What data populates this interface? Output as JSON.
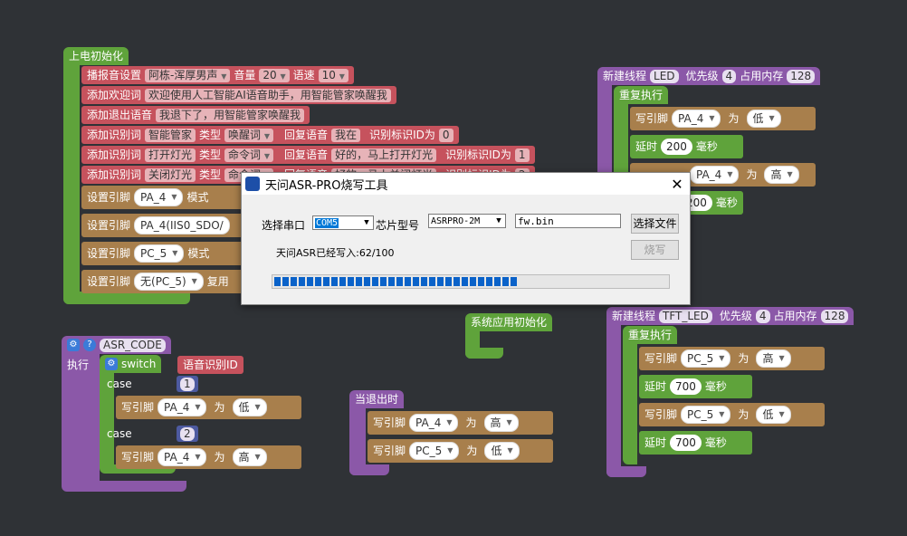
{
  "init_block": {
    "hat": "上电初始化",
    "rows": [
      {
        "kind": "tts",
        "label": "播报音设置",
        "voice": "阿栋-浑厚男声",
        "vol_label": "音量",
        "vol": "20",
        "speed_label": "语速",
        "speed": "10"
      },
      {
        "label": "添加欢迎词",
        "text": "欢迎使用人工智能AI语音助手，用智能管家唤醒我"
      },
      {
        "label": "添加退出语音",
        "text": "我退下了，用智能管家唤醒我"
      },
      {
        "label": "添加识别词",
        "word": "智能管家",
        "type_label": "类型",
        "type": "唤醒词",
        "reply_label": "回复语音",
        "reply": "我在",
        "id_label": "识别标识ID为",
        "id": "0"
      },
      {
        "label": "添加识别词",
        "word": "打开灯光",
        "type_label": "类型",
        "type": "命令词",
        "reply_label": "回复语音",
        "reply": "好的，马上打开灯光",
        "id_label": "识别标识ID为",
        "id": "1"
      },
      {
        "label": "添加识别词",
        "word": "关闭灯光",
        "type_label": "类型",
        "type": "命令词",
        "reply_label": "回复语音",
        "reply": "好的，马上关闭灯光",
        "id_label": "识别标识ID为",
        "id": "2"
      }
    ],
    "pins": [
      {
        "label": "设置引脚",
        "pin": "PA_4",
        "mode_label": "模式"
      },
      {
        "label": "设置引脚",
        "pin": "PA_4(IIS0_SDO/"
      },
      {
        "label": "设置引脚",
        "pin": "PC_5",
        "mode_label": "模式"
      },
      {
        "label": "设置引脚",
        "pin": "无(PC_5)",
        "mode_label": "复用"
      }
    ]
  },
  "thread_led": {
    "hat_label": "新建线程",
    "name": "LED",
    "prio_label": "优先级",
    "prio": "4",
    "mem_label": "占用内存",
    "mem": "128",
    "repeat": "重复执行",
    "write1": {
      "label": "写引脚",
      "pin": "PA_4",
      "as": "为",
      "val": "低"
    },
    "delay1": {
      "label": "延时",
      "val": "200",
      "unit": "毫秒"
    },
    "write2": {
      "label": "写引脚",
      "pin": "PA_4",
      "as": "为",
      "val": "高"
    },
    "delay2": {
      "val": "200",
      "unit": "毫秒"
    }
  },
  "thread_tft": {
    "hat_label": "新建线程",
    "name": "TFT_LED",
    "prio_label": "优先级",
    "prio": "4",
    "mem_label": "占用内存",
    "mem": "128",
    "repeat": "重复执行",
    "write1": {
      "label": "写引脚",
      "pin": "PC_5",
      "as": "为",
      "val": "高"
    },
    "delay1": {
      "label": "延时",
      "val": "700",
      "unit": "毫秒"
    },
    "write2": {
      "label": "写引脚",
      "pin": "PC_5",
      "as": "为",
      "val": "低"
    },
    "delay2": {
      "label": "延时",
      "val": "700",
      "unit": "毫秒"
    }
  },
  "asr_block": {
    "name": "ASR_CODE",
    "exec": "执行",
    "switch": "switch",
    "switch_arg": "语音识别ID",
    "case_label": "case",
    "case1": "1",
    "case2": "2",
    "write1": {
      "label": "写引脚",
      "pin": "PA_4",
      "as": "为",
      "val": "低"
    },
    "write2": {
      "label": "写引脚",
      "pin": "PA_4",
      "as": "为",
      "val": "高"
    }
  },
  "sys_init": "系统应用初始化",
  "exit_block": {
    "hat": "当退出时",
    "write1": {
      "label": "写引脚",
      "pin": "PA_4",
      "as": "为",
      "val": "高"
    },
    "write2": {
      "label": "写引脚",
      "pin": "PC_5",
      "as": "为",
      "val": "低"
    }
  },
  "dialog": {
    "title": "天问ASR-PRO烧写工具",
    "port_label": "选择串口",
    "port": "COM5",
    "chip_label": "芯片型号",
    "chip": "ASRPRO-2M",
    "file": "fw.bin",
    "select_file": "选择文件",
    "status": "天问ASR已经写入:62/100",
    "burn": "烧写",
    "progress": 0.62
  }
}
